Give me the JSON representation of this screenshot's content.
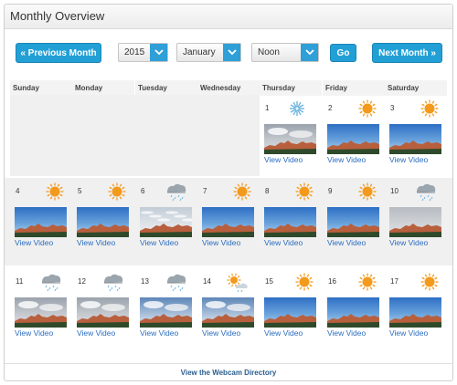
{
  "panel": {
    "title": "Monthly Overview"
  },
  "nav": {
    "prev_label": "« Previous Month",
    "next_label": "Next Month »",
    "go_label": "Go",
    "year_value": "2015",
    "month_value": "January",
    "time_value": "Noon"
  },
  "weekdays": [
    "Sunday",
    "Monday",
    "Tuesday",
    "Wednesday",
    "Thursday",
    "Friday",
    "Saturday"
  ],
  "days": [
    {
      "num": "1",
      "weather": "snow",
      "thumb": "cloudy",
      "link": "View Video"
    },
    {
      "num": "2",
      "weather": "sunny",
      "thumb": "clear",
      "link": "View Video"
    },
    {
      "num": "3",
      "weather": "sunny",
      "thumb": "clear",
      "link": "View Video"
    },
    {
      "num": "4",
      "weather": "sunny",
      "thumb": "clear",
      "link": "View Video"
    },
    {
      "num": "5",
      "weather": "sunny",
      "thumb": "clear",
      "link": "View Video"
    },
    {
      "num": "6",
      "weather": "cloudy-rain",
      "thumb": "streaky",
      "link": "View Video"
    },
    {
      "num": "7",
      "weather": "sunny",
      "thumb": "clear",
      "link": "View Video"
    },
    {
      "num": "8",
      "weather": "sunny",
      "thumb": "clear",
      "link": "View Video"
    },
    {
      "num": "9",
      "weather": "sunny",
      "thumb": "clear",
      "link": "View Video"
    },
    {
      "num": "10",
      "weather": "cloudy-rain",
      "thumb": "overcast",
      "link": "View Video"
    },
    {
      "num": "11",
      "weather": "cloudy-rain",
      "thumb": "cloudy",
      "link": "View Video"
    },
    {
      "num": "12",
      "weather": "cloudy-rain",
      "thumb": "cloudy",
      "link": "View Video"
    },
    {
      "num": "13",
      "weather": "cloudy-rain",
      "thumb": "partly",
      "link": "View Video"
    },
    {
      "num": "14",
      "weather": "partly-sunny",
      "thumb": "partly",
      "link": "View Video"
    },
    {
      "num": "15",
      "weather": "sunny",
      "thumb": "clear",
      "link": "View Video"
    },
    {
      "num": "16",
      "weather": "sunny",
      "thumb": "clear",
      "link": "View Video"
    },
    {
      "num": "17",
      "weather": "sunny",
      "thumb": "clear",
      "link": "View Video"
    }
  ],
  "footer": {
    "link": "View the Webcam Directory"
  },
  "colors": {
    "accent": "#22a0d6",
    "link": "#2a6cbf",
    "sun": "#f39a1d"
  }
}
